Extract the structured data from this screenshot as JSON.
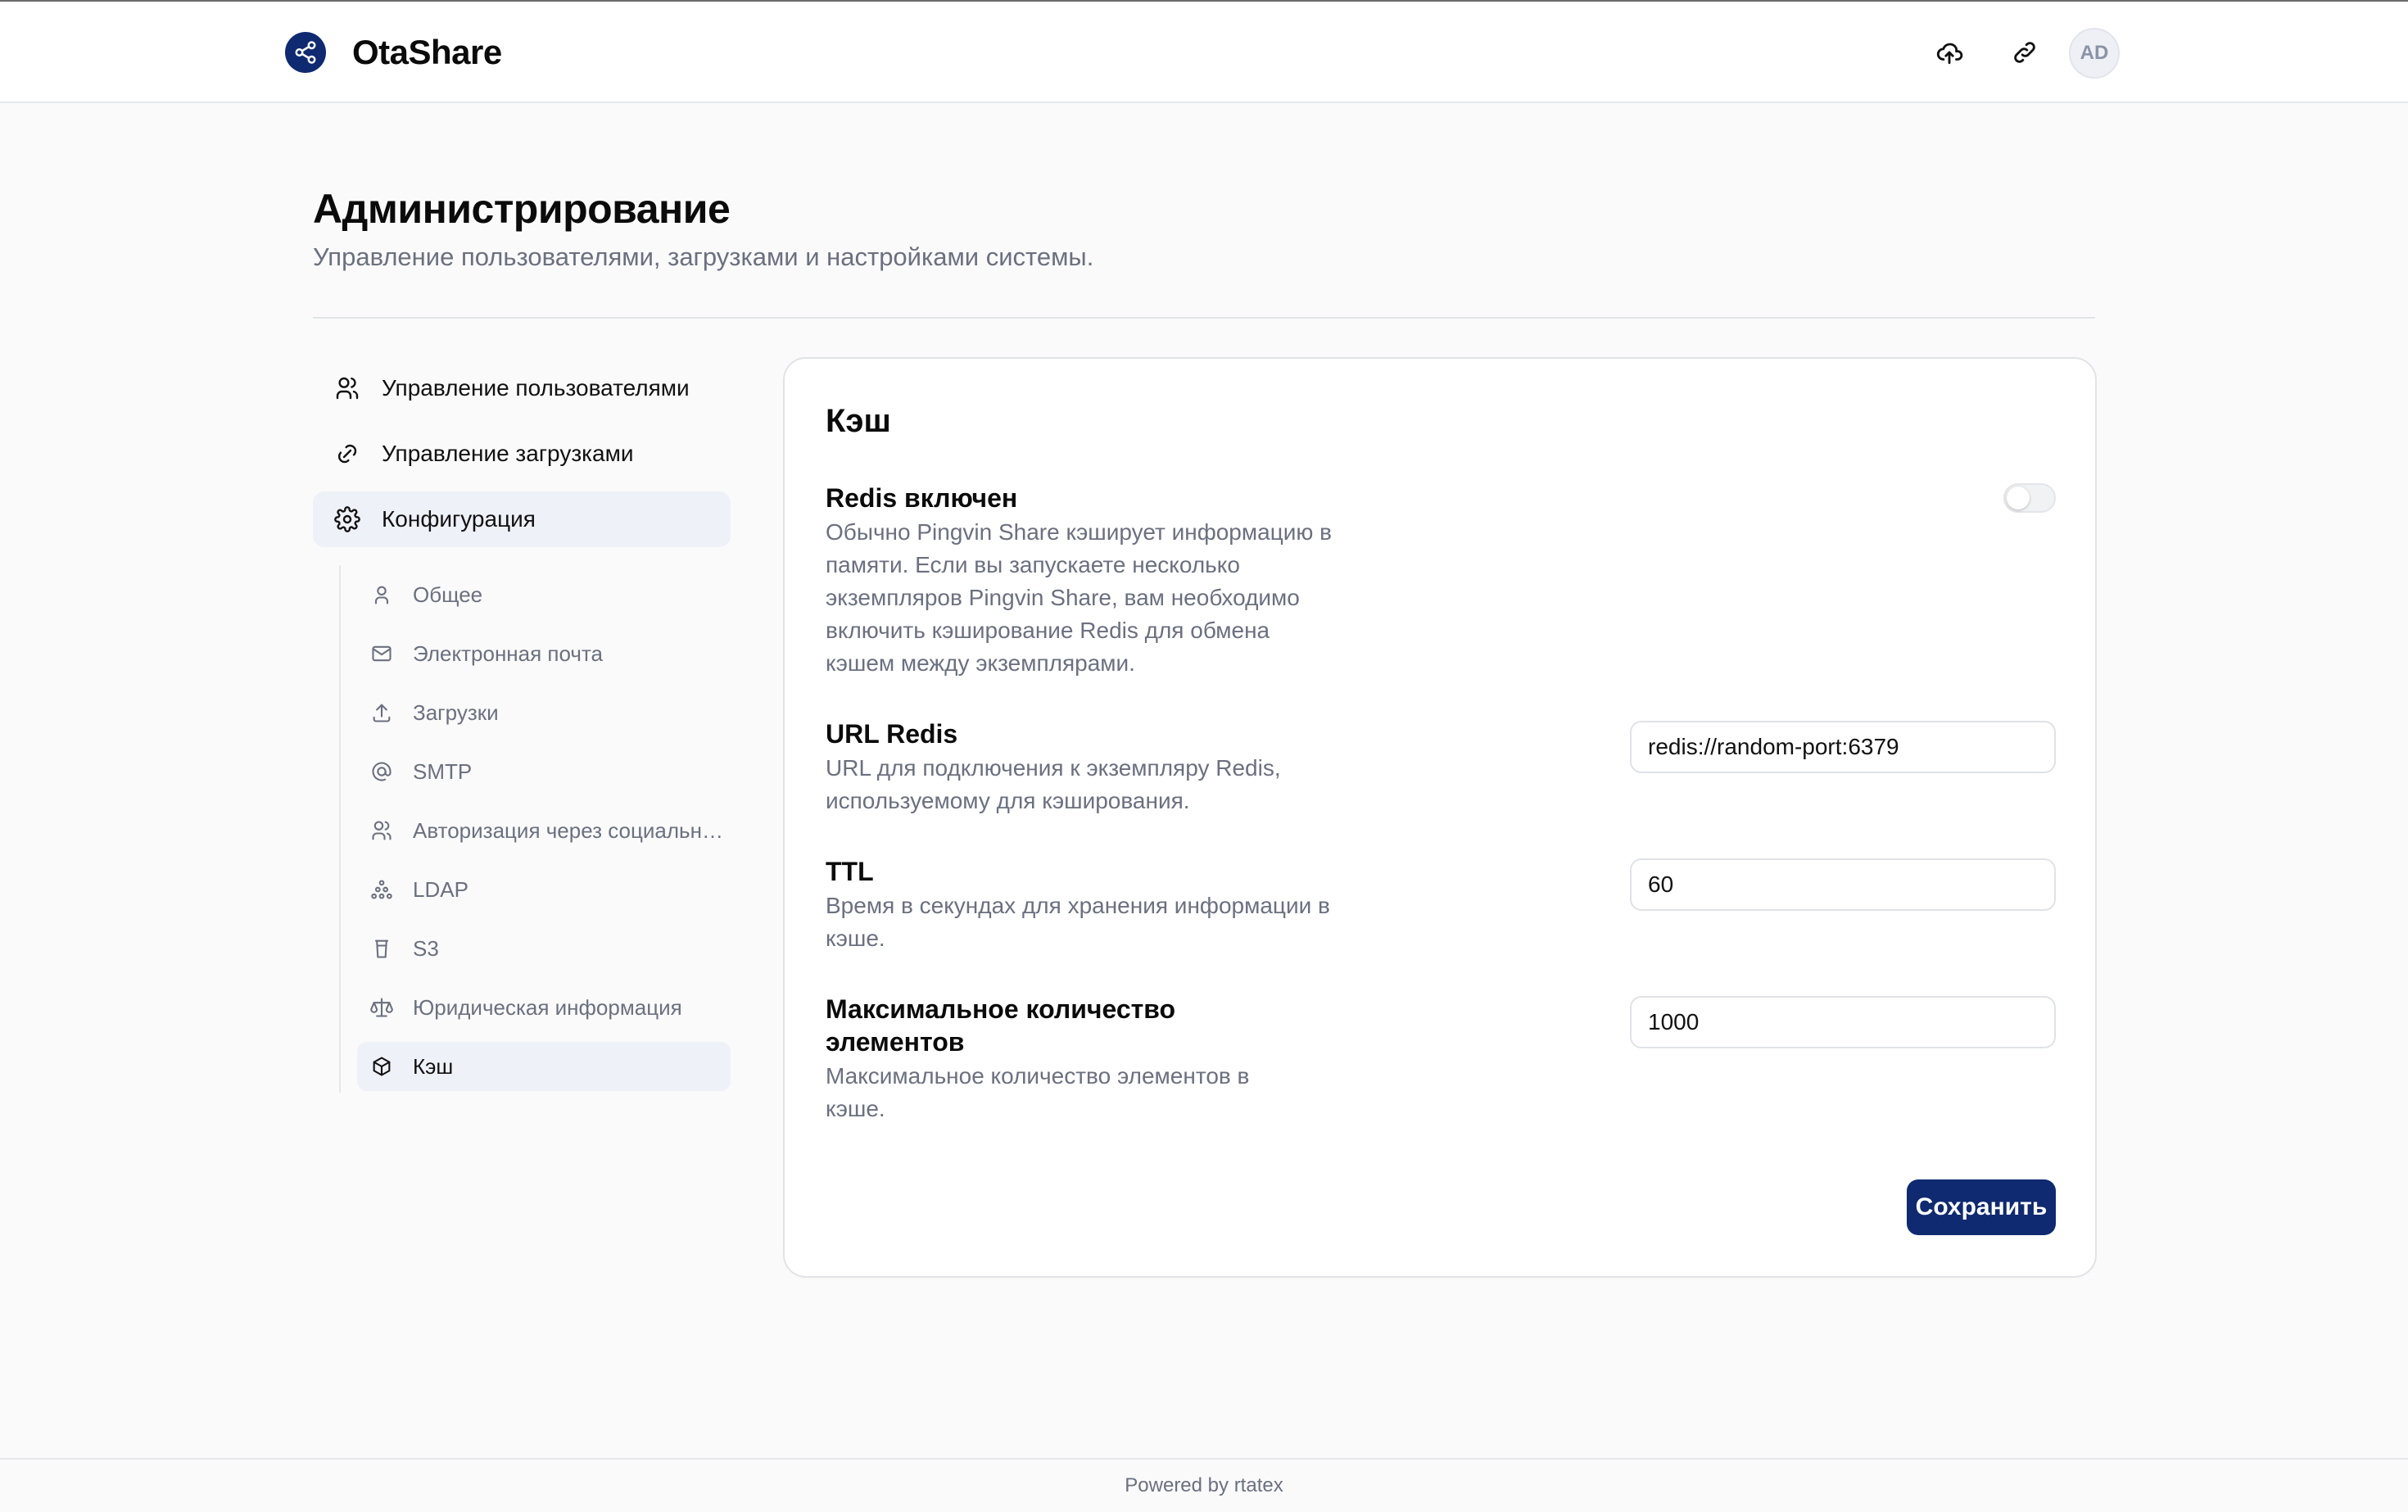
{
  "app": {
    "name": "OtaShare",
    "avatar_initials": "AD"
  },
  "header": {
    "upload_icon": "cloud-upload-icon",
    "link_icon": "link-icon",
    "logo_icon": "share-icon"
  },
  "page": {
    "title": "Администрирование",
    "subtitle": "Управление пользователями, загрузками и настройками системы."
  },
  "nav": {
    "items": [
      {
        "label": "Управление пользователями",
        "icon": "users-icon"
      },
      {
        "label": "Управление загрузками",
        "icon": "link-icon"
      },
      {
        "label": "Конфигурация",
        "icon": "gear-icon",
        "active": true
      }
    ],
    "sub_items": [
      {
        "label": "Общее",
        "icon": "user-icon"
      },
      {
        "label": "Электронная почта",
        "icon": "mail-icon"
      },
      {
        "label": "Загрузки",
        "icon": "upload-icon"
      },
      {
        "label": "SMTP",
        "icon": "at-icon"
      },
      {
        "label": "Авторизация через социальные сети",
        "icon": "users-icon"
      },
      {
        "label": "LDAP",
        "icon": "network-icon"
      },
      {
        "label": "S3",
        "icon": "bucket-icon"
      },
      {
        "label": "Юридическая информация",
        "icon": "scale-icon"
      },
      {
        "label": "Кэш",
        "icon": "cube-icon",
        "active": true
      }
    ]
  },
  "card": {
    "title": "Кэш",
    "settings": {
      "redis_enabled": {
        "title": "Redis включен",
        "description": "Обычно Pingvin Share кэширует информацию в памяти. Если вы запускаете несколько экземпляров Pingvin Share, вам необходимо включить кэширование Redis для обмена кэшем между экземплярами.",
        "value": false
      },
      "redis_url": {
        "title": "URL Redis",
        "description": "URL для подключения к экземпляру Redis, используемому для кэширования.",
        "value": "redis://random-port:6379"
      },
      "ttl": {
        "title": "TTL",
        "description": "Время в секундах для хранения информации в кэше.",
        "value": "60"
      },
      "max_items": {
        "title": "Максимальное количество элементов",
        "description": "Максимальное количество элементов в кэше.",
        "value": "1000"
      }
    },
    "save_label": "Сохранить"
  },
  "footer": {
    "text": "Powered by rtatex"
  },
  "colors": {
    "brand": "#0f2a70",
    "muted_text": "#6b7080",
    "active_bg": "#eef1f8"
  }
}
